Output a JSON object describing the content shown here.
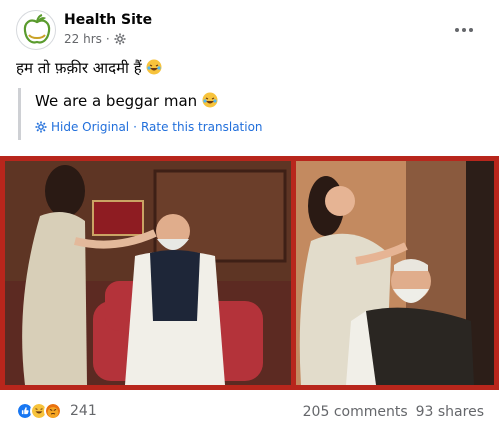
{
  "post": {
    "page_name": "Health Site",
    "time": "22 hrs",
    "privacy_icon": "public-gear-icon",
    "original_text": "हम तो फ़क़ीर आदमी हैं",
    "emoji_icon": "rofl-emoji-icon"
  },
  "translation": {
    "text": "We are a beggar man",
    "hide_label": "Hide Original",
    "separator": "·",
    "rate_label": "Rate this translation"
  },
  "footer": {
    "reaction_icons": [
      "like-reaction-icon",
      "haha-reaction-icon",
      "angry-reaction-icon"
    ],
    "reaction_count": "241",
    "comments": "205 comments",
    "shares": "93 shares"
  },
  "colors": {
    "link": "#216fdb",
    "photo_border": "#b8261c",
    "meta": "#65676b"
  }
}
